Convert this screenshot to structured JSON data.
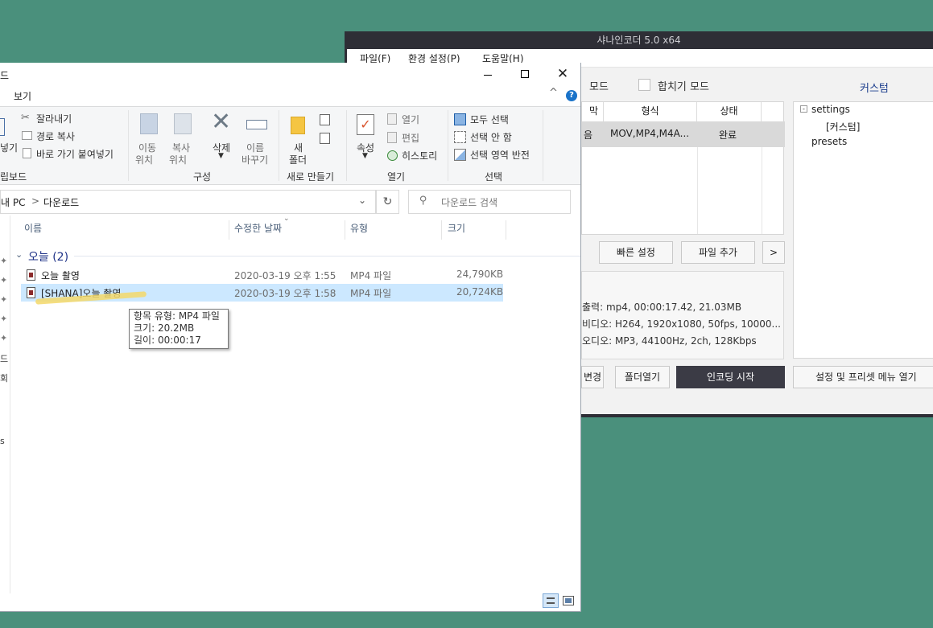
{
  "shana": {
    "title": "샤나인코더  5.0 x64",
    "menu": [
      "파일(F)",
      "환경 설정(P)",
      "도움말(H)"
    ],
    "mode_left": "모드",
    "merge_mode": "합치기 모드",
    "custom_tab": "커스텀",
    "list_headers": [
      "막",
      "형식",
      "상태"
    ],
    "list_row": {
      "name_tail": "음",
      "format": "MOV,MP4,M4A...",
      "status": "완료"
    },
    "tree": {
      "root": "settings",
      "child": "[커스텀]",
      "sibling": "presets"
    },
    "buttons": {
      "quick_setting": "빠른 설정",
      "add_file": "파일 추가",
      "next": ">",
      "change": "변경",
      "open_folder": "폴더열기",
      "start": "인코딩 시작",
      "preset_menu": "설정 및 프리셋 메뉴 열기"
    },
    "info": {
      "output": "출력: mp4, 00:00:17.42, 21.03MB",
      "video": "비디오: H264, 1920x1080, 50fps, 10000...",
      "audio": "오디오: MP3, 44100Hz, 2ch, 128Kbps"
    }
  },
  "explorer": {
    "title_fragment": "드",
    "tabs": {
      "view": "보기"
    },
    "ribbon": {
      "clipboard": {
        "cut": "잘라내기",
        "copy_path": "경로 복사",
        "paste_shortcut": "바로 가기 붙여넣기",
        "paste_fragment": "넣기",
        "group_fragment": "립보드"
      },
      "organize": {
        "move_to": "이동\n위치",
        "move_line1": "이동",
        "move_line2": "위치",
        "copy_line1": "복사",
        "copy_line2": "위치",
        "delete": "삭제",
        "rename_line1": "이름",
        "rename_line2": "바꾸기",
        "group": "구성"
      },
      "new": {
        "folder_line1": "새",
        "folder_line2": "폴더",
        "group": "새로 만들기"
      },
      "open": {
        "properties": "속성",
        "open": "열기",
        "edit": "편집",
        "history": "히스토리",
        "group": "열기"
      },
      "select": {
        "select_all": "모두 선택",
        "select_none": "선택 안 함",
        "invert": "선택 영역 반전",
        "group": "선택"
      }
    },
    "address": {
      "root": "내 PC",
      "sep": ">",
      "folder": "다운로드"
    },
    "search_placeholder": "다운로드 검색",
    "columns": {
      "name": "이름",
      "modified": "수정한 날짜",
      "type": "유형",
      "size": "크기"
    },
    "group_header": "오늘 (2)",
    "files": [
      {
        "name": "오늘 촬영",
        "modified": "2020-03-19 오후 1:55",
        "type": "MP4 파일",
        "size": "24,790KB"
      },
      {
        "name": "[SHANA]오늘 촬영",
        "modified": "2020-03-19 오후 1:58",
        "type": "MP4 파일",
        "size": "20,724KB"
      }
    ],
    "tooltip": {
      "type": "항목 유형: MP4 파일",
      "size": "크기: 20.2MB",
      "length": "길이: 00:00:17"
    },
    "left_pane": [
      "드",
      "회",
      "s"
    ]
  },
  "colors": {
    "desktop": "#4a907c",
    "selection": "#cce8ff",
    "highlight": "#f3d86a",
    "accent": "#1a73c9"
  }
}
